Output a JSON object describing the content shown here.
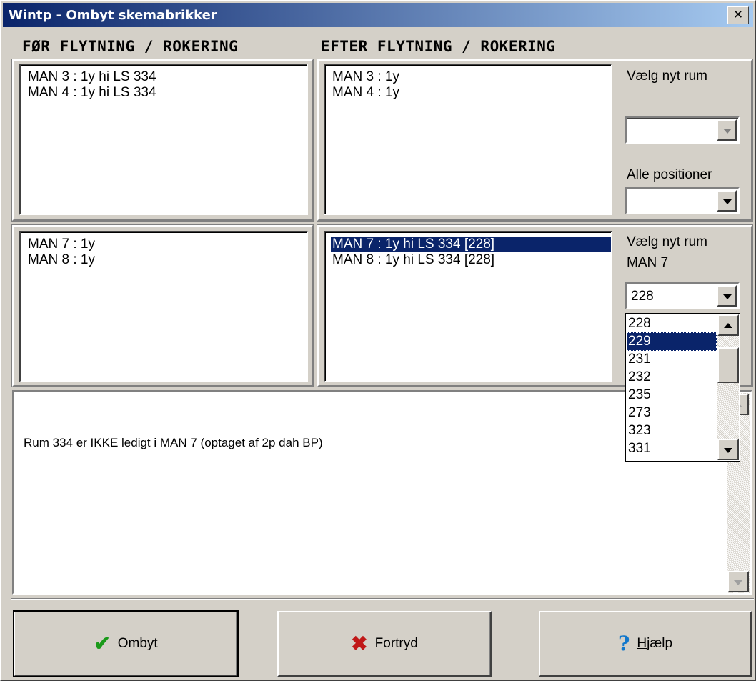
{
  "window": {
    "title": "Wintp - Ombyt skemabrikker",
    "close_glyph": "✕"
  },
  "headers": {
    "before": "FØR  FLYTNING / ROKERING",
    "after": "EFTER  FLYTNING / ROKERING"
  },
  "top": {
    "before_items": [
      "MAN 3 : 1y hi LS 334",
      "MAN 4 : 1y hi LS 334"
    ],
    "after_items": [
      "MAN 3 : 1y",
      "MAN 4 : 1y"
    ],
    "choose_room_label": "Vælg nyt rum",
    "room_combo_value": "",
    "all_positions_label": "Alle positioner",
    "positions_combo_value": ""
  },
  "bottom": {
    "before_items": [
      "MAN 7 : 1y",
      "MAN 8 : 1y"
    ],
    "after_items": [
      "MAN 7 : 1y hi LS 334 [228]",
      "MAN 8 : 1y hi LS 334 [228]"
    ],
    "after_selected_index": 0,
    "choose_room_label": "Vælg nyt rum",
    "day_label": "MAN 7",
    "room_combo_value": "228",
    "dropdown_options": [
      "228",
      "229",
      "231",
      "232",
      "235",
      "273",
      "323",
      "331"
    ],
    "dropdown_highlight": "229"
  },
  "message": "Rum 334 er IKKE ledigt i  MAN 7  (optaget af 2p dah BP)",
  "buttons": {
    "ok": {
      "label": "Ombyt",
      "icon": "check-icon"
    },
    "cancel": {
      "label": "Fortryd",
      "icon": "cross-icon"
    },
    "help": {
      "label_accel": "H",
      "label_rest": "jælp",
      "icon": "help-icon"
    }
  }
}
